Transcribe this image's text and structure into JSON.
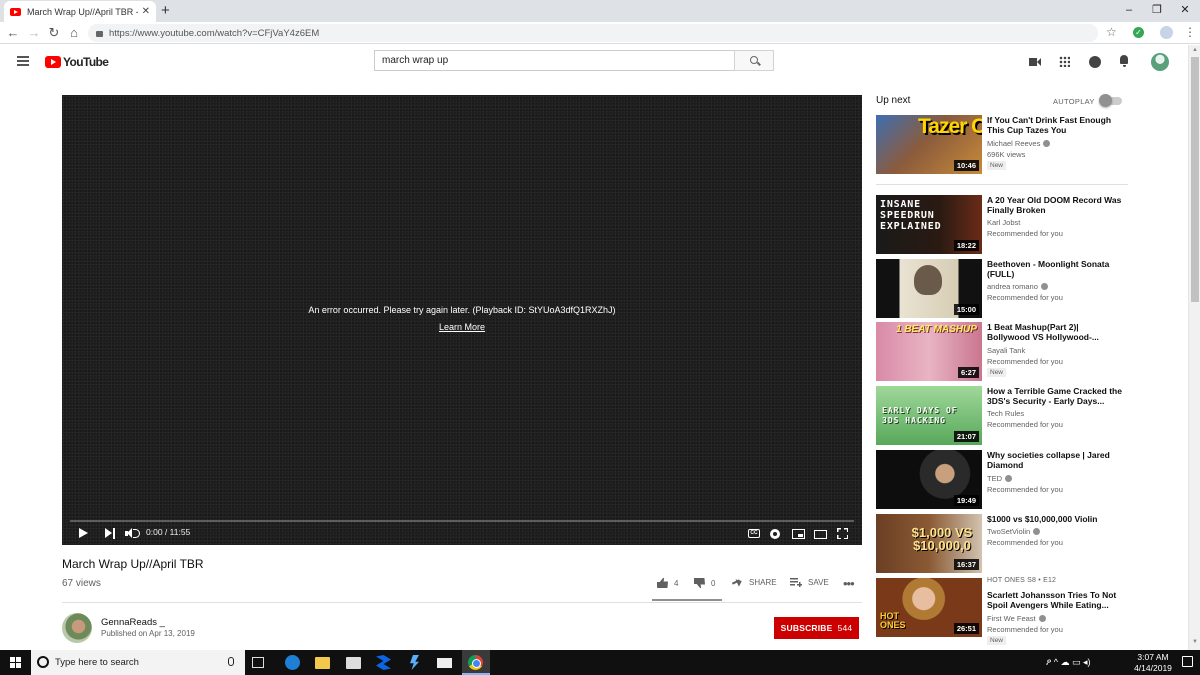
{
  "browser": {
    "tab_title": "March Wrap Up//April TBR - YouTube",
    "new_tab": "+",
    "url": "https://www.youtube.com/watch?v=CFjVaY4z6EM",
    "window_controls": [
      "–",
      "❐",
      "✕"
    ],
    "nav": {
      "back": "←",
      "forward": "→",
      "reload": "↻",
      "home": "⌂"
    },
    "star": "☆"
  },
  "youtube": {
    "logo_text": "YouTube",
    "search_query": "march wrap up",
    "icons": [
      "video-camera-icon",
      "apps-icon",
      "messages-icon",
      "bell-icon",
      "account-avatar"
    ]
  },
  "player": {
    "error_message": "An error occurred. Please try again later. (Playback ID: StYUoA3dfQ1RXZhJ)",
    "learn_more": "Learn More",
    "time": "0:00 / 11:55",
    "progress": 0,
    "cc_label": "CC"
  },
  "video": {
    "title": "March Wrap Up//April TBR",
    "views": "67 views",
    "likes": "4",
    "dislikes": "0",
    "share_label": "SHARE",
    "save_label": "SAVE",
    "more": "•••",
    "channel": "GennaReads _",
    "published": "Published on Apr 13, 2019",
    "subscribe_label": "SUBSCRIBE",
    "subscriber_count": "544"
  },
  "sidebar": {
    "up_next": "Up next",
    "autoplay_label": "AUTOPLAY",
    "autoplay_on": false,
    "items": [
      {
        "title": "If You Can't Drink Fast Enough This Cup Tazes You",
        "channel": "Michael Reeves",
        "verified": true,
        "meta": "696K views",
        "badge": "New",
        "duration": "10:46",
        "thumb_text": "Tazer Cup"
      },
      {
        "title": "A 20 Year Old DOOM Record Was Finally Broken",
        "channel": "Karl Jobst",
        "verified": false,
        "meta": "Recommended for you",
        "badge": "",
        "duration": "18:22",
        "thumb_text": "INSANE SPEEDRUN EXPLAINED"
      },
      {
        "title": "Beethoven - Moonlight Sonata (FULL)",
        "channel": "andrea romano",
        "verified": true,
        "meta": "Recommended for you",
        "badge": "",
        "duration": "15:00",
        "thumb_text": ""
      },
      {
        "title": "1 Beat Mashup(Part 2)| Bollywood VS Hollywood-...",
        "channel": "Sayali Tank",
        "verified": false,
        "meta": "Recommended for you",
        "badge": "New",
        "duration": "6:27",
        "thumb_text": "1 BEAT MASHUP"
      },
      {
        "title": "How a Terrible Game Cracked the 3DS's Security - Early Days...",
        "channel": "Tech Rules",
        "verified": false,
        "meta": "Recommended for you",
        "badge": "",
        "duration": "21:07",
        "thumb_text": "EARLY DAYS OF 3DS HACKING"
      },
      {
        "title": "Why societies collapse | Jared Diamond",
        "channel": "TED",
        "verified": true,
        "meta": "Recommended for you",
        "badge": "",
        "duration": "19:49",
        "thumb_text": ""
      },
      {
        "title": "$1000 vs $10,000,000 Violin",
        "channel": "TwoSetViolin",
        "verified": true,
        "meta": "Recommended for you",
        "badge": "",
        "duration": "16:37",
        "thumb_text": "$1,000 VS $10,000,0"
      },
      {
        "kicker": "HOT ONES  S8 • E12",
        "title": "Scarlett Johansson Tries To Not Spoil Avengers While Eating...",
        "channel": "First We Feast",
        "verified": true,
        "meta": "Recommended for you",
        "badge": "New",
        "duration": "26:51",
        "thumb_text": "HOT ONES"
      }
    ]
  },
  "taskbar": {
    "search_placeholder": "Type here to search",
    "time": "3:07 AM",
    "date": "4/14/2019",
    "tray_text": "ዖ ^ ☁ ▭ ◂)"
  },
  "colors": {
    "youtube_red": "#ff0000",
    "subscribe_red": "#cc0000",
    "player_bg": "#1d1d1d"
  }
}
